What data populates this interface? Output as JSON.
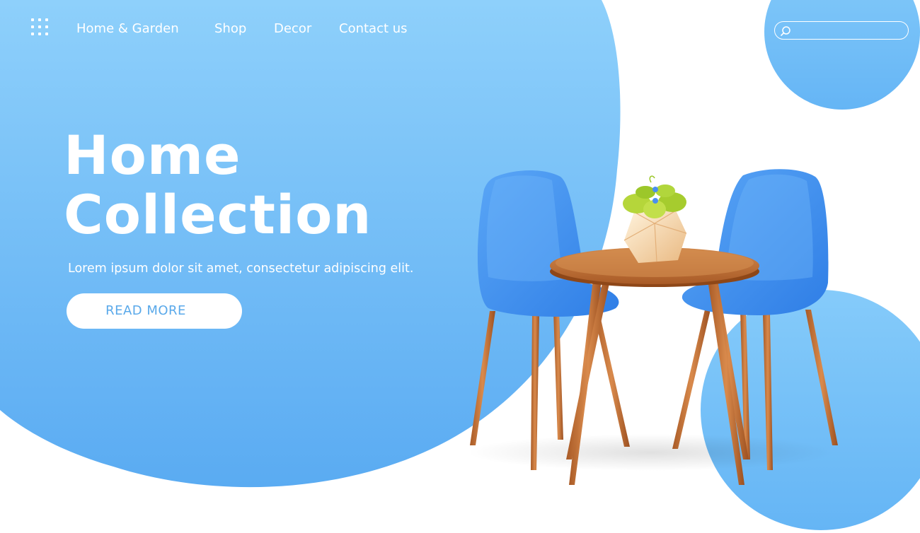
{
  "nav": {
    "links": [
      {
        "label": "Home & Garden"
      },
      {
        "label": "Shop"
      },
      {
        "label": "Decor"
      },
      {
        "label": "Contact us"
      }
    ],
    "menu_icon": "grid-menu-icon"
  },
  "search": {
    "placeholder": "",
    "icon": "search-icon"
  },
  "hero": {
    "title_line1": "Home",
    "title_line2": "Collection",
    "subtitle": "Lorem ipsum dolor sit amet, consectetur adipiscing elit.",
    "cta_label": "READ MORE"
  },
  "colors": {
    "blue_light": "#8ed0fb",
    "blue_main": "#63b4f4",
    "chair_blue": "#3d8bf0",
    "wood": "#c8743a",
    "cta_text": "#5aa9ea",
    "white": "#ffffff"
  },
  "illustration": {
    "items": [
      "chair-left",
      "round-table",
      "plant-pot",
      "chair-right"
    ]
  }
}
